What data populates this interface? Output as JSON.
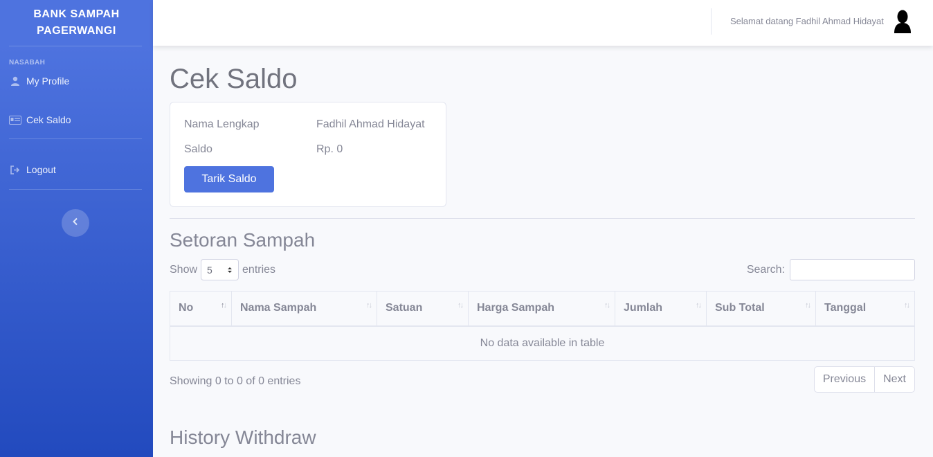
{
  "sidebar": {
    "brand_line1": "BANK SAMPAH",
    "brand_line2": "PAGERWANGI",
    "heading": "NASABAH",
    "items": [
      {
        "label": "My Profile",
        "icon": "user-icon"
      },
      {
        "label": "Cek Saldo",
        "icon": "id-card-icon"
      },
      {
        "label": "Logout",
        "icon": "sign-out-icon"
      }
    ]
  },
  "topbar": {
    "welcome": "Selamat datang Fadhil Ahmad Hidayat"
  },
  "page": {
    "title": "Cek Saldo"
  },
  "account": {
    "name_label": "Nama Lengkap",
    "name_value": "Fadhil Ahmad Hidayat",
    "balance_label": "Saldo",
    "balance_value": "Rp. 0",
    "withdraw_button": "Tarik Saldo"
  },
  "setoran": {
    "title": "Setoran Sampah",
    "show_label": "Show",
    "entries_value": "5",
    "entries_label": "entries",
    "search_label": "Search:",
    "columns": [
      "No",
      "Nama Sampah",
      "Satuan",
      "Harga Sampah",
      "Jumlah",
      "Sub Total",
      "Tanggal"
    ],
    "empty_message": "No data available in table",
    "showing": "Showing 0 to 0 of 0 entries",
    "prev_label": "Previous",
    "next_label": "Next"
  },
  "history": {
    "title": "History Withdraw"
  },
  "colors": {
    "primary": "#4e73df",
    "sidebar_gradient_end": "#224abe"
  }
}
